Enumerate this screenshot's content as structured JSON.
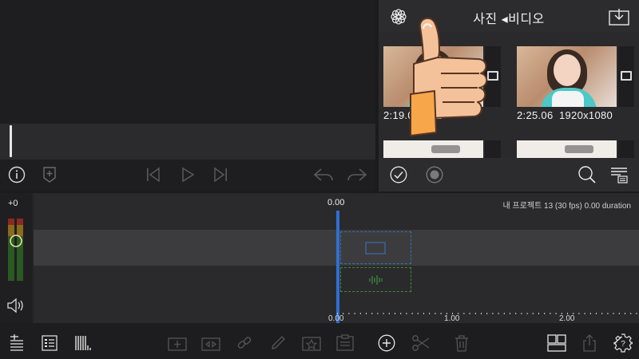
{
  "browser": {
    "title": "사진 ◂비디오",
    "items": [
      {
        "duration": "2:19.08",
        "resolution": "192"
      },
      {
        "duration": "2:25.06",
        "resolution": "1920x1080"
      }
    ]
  },
  "timeline": {
    "current_time": "0.00",
    "project_info": "내 프로젝트 13 (30 fps)  0.00 duration",
    "meter_label": "+0",
    "ruler_labels": [
      "0.00",
      "1.00",
      "2.00"
    ]
  },
  "colors": {
    "playhead": "#2f6fd0",
    "video_placeholder": "#3a6db0",
    "audio_placeholder": "#3c8a3c"
  },
  "icons": {
    "browser_head": [
      "flower-icon",
      "import-icon"
    ],
    "preview_controls": [
      "info-icon",
      "marker-icon",
      "skip-start-icon",
      "play-icon",
      "skip-end-icon",
      "undo-icon",
      "redo-icon"
    ],
    "browser_foot": [
      "checkmark-icon",
      "record-icon",
      "search-icon",
      "list-icon"
    ],
    "toolbar": [
      "add-track-icon",
      "track-list-icon",
      "barcode-icon",
      "split-clip-icon",
      "transition-icon",
      "link-icon",
      "pencil-icon",
      "favorite-icon",
      "clipboard-icon",
      "add-icon",
      "scissors-icon",
      "trash-icon",
      "layout-icon",
      "share-icon",
      "settings-icon"
    ]
  }
}
